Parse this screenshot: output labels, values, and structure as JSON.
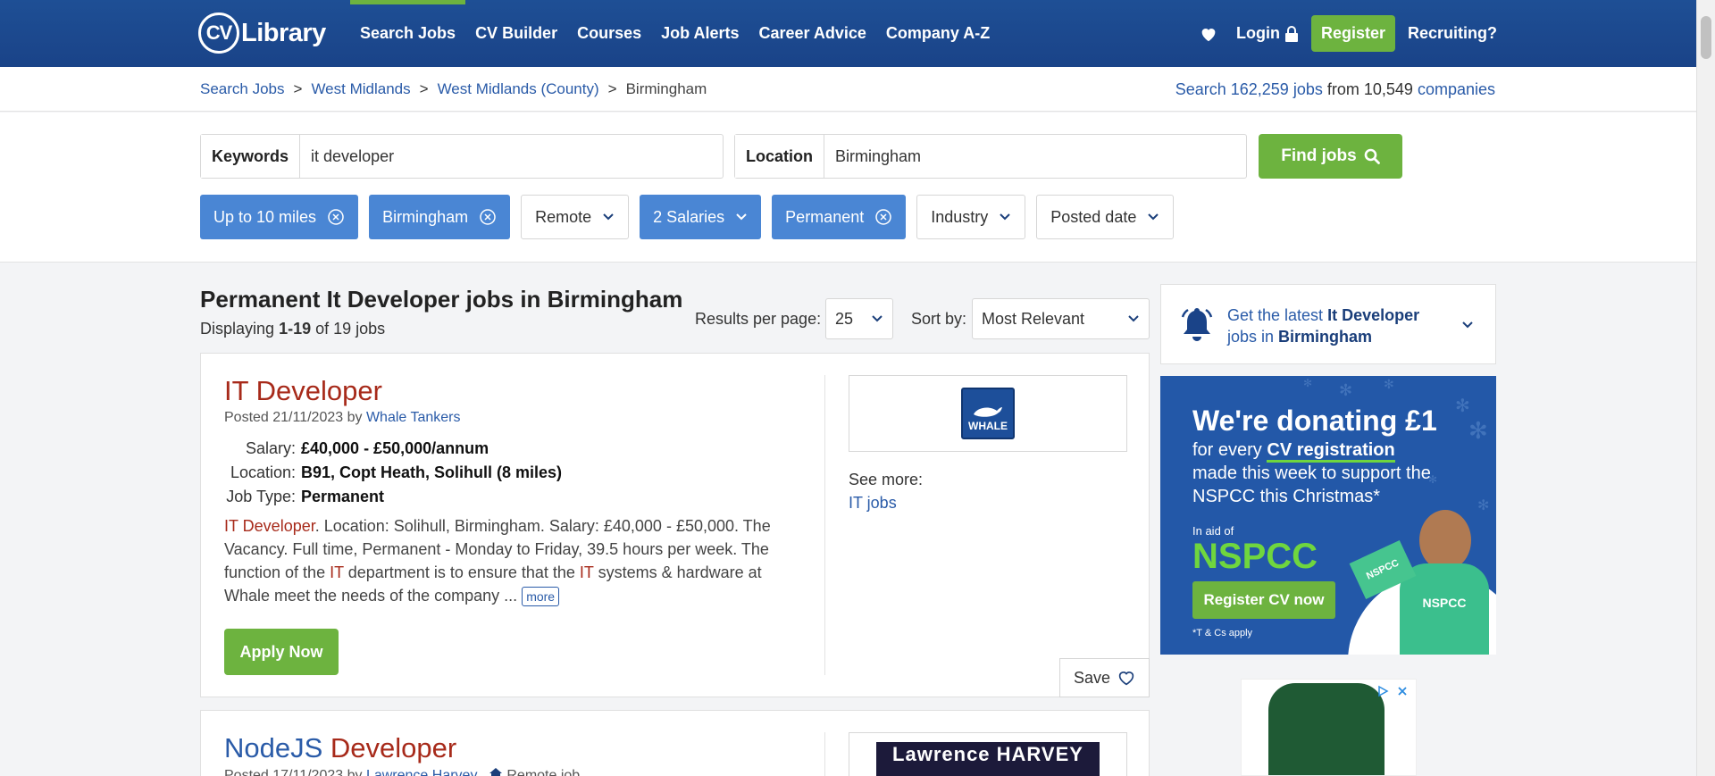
{
  "header": {
    "logo_mark": "CV",
    "logo_text": "Library",
    "nav": [
      "Search Jobs",
      "CV Builder",
      "Courses",
      "Job Alerts",
      "Career Advice",
      "Company A-Z"
    ],
    "login": "Login",
    "register": "Register",
    "recruiting": "Recruiting?"
  },
  "breadcrumb": [
    "Search Jobs",
    "West Midlands",
    "West Midlands (County)",
    "Birmingham"
  ],
  "stats": {
    "prefix": "Search",
    "jobs": "162,259 jobs",
    "mid": "from",
    "count": "10,549",
    "companies": "companies"
  },
  "search": {
    "keywords_label": "Keywords",
    "keywords_value": "it developer",
    "location_label": "Location",
    "location_value": "Birmingham",
    "find_button": "Find jobs"
  },
  "filters": [
    {
      "label": "Up to 10 miles",
      "active": true,
      "control": "clear"
    },
    {
      "label": "Birmingham",
      "active": true,
      "control": "clear"
    },
    {
      "label": "Remote",
      "active": false,
      "control": "dropdown"
    },
    {
      "label": "2 Salaries",
      "active": true,
      "control": "dropdown"
    },
    {
      "label": "Permanent",
      "active": true,
      "control": "clear"
    },
    {
      "label": "Industry",
      "active": false,
      "control": "dropdown"
    },
    {
      "label": "Posted date",
      "active": false,
      "control": "dropdown"
    }
  ],
  "results": {
    "title": "Permanent It Developer jobs in Birmingham",
    "displaying_prefix": "Displaying",
    "displaying_range": "1-19",
    "displaying_suffix": "of 19 jobs",
    "per_page_label": "Results per page:",
    "per_page_value": "25",
    "sort_label": "Sort by:",
    "sort_value": "Most Relevant"
  },
  "jobs": [
    {
      "title_part1": "IT Developer",
      "title_part2": "",
      "posted": "Posted 21/11/2023 by",
      "company": "Whale Tankers",
      "salary_label": "Salary:",
      "salary": "£40,000 - £50,000/annum",
      "location_label": "Location:",
      "location": "B91, Copt Heath, Solihull (8 miles)",
      "type_label": "Job Type:",
      "type": "Permanent",
      "desc_a": "IT Developer",
      "desc_b": ". Location: Solihull, Birmingham. Salary: £40,000 - £50,000. The Vacancy. Full time, Permanent - Monday to Friday, 39.5 hours per week. The function of the ",
      "desc_c": "IT",
      "desc_d": " department is to ensure that the ",
      "desc_e": "IT",
      "desc_f": " systems & hardware at Whale meet the needs of the company ... ",
      "more": "more",
      "apply": "Apply Now",
      "logo_text": "WHALE",
      "see_more": "See more:",
      "see_more_link": "IT jobs",
      "save": "Save"
    },
    {
      "title_part1": "NodeJS",
      "title_part2": "Developer",
      "posted": "Posted 17/11/2023 by",
      "company": "Lawrence Harvey",
      "remote": "Remote job",
      "logo_text": "Lawrence HARVEY"
    }
  ],
  "alert": {
    "prefix": "Get the latest",
    "keyword": "It Developer",
    "mid": "jobs in",
    "place": "Birmingham"
  },
  "ad": {
    "headline": "We're donating £1",
    "line1": "for every",
    "line1b": "CV registration",
    "line2": "made this week to support the NSPCC this Christmas*",
    "aid": "In aid of",
    "brand": "NSPCC",
    "button": "Register CV now",
    "tc": "*T & Cs apply",
    "shirt": "NSPCC",
    "flag": "NSPCC"
  },
  "colors": {
    "header": "#1e4f95",
    "accent_green": "#6db33f",
    "chip_active": "#4a86d4",
    "title_red": "#a72a1a",
    "link_blue": "#2a5ba8"
  }
}
